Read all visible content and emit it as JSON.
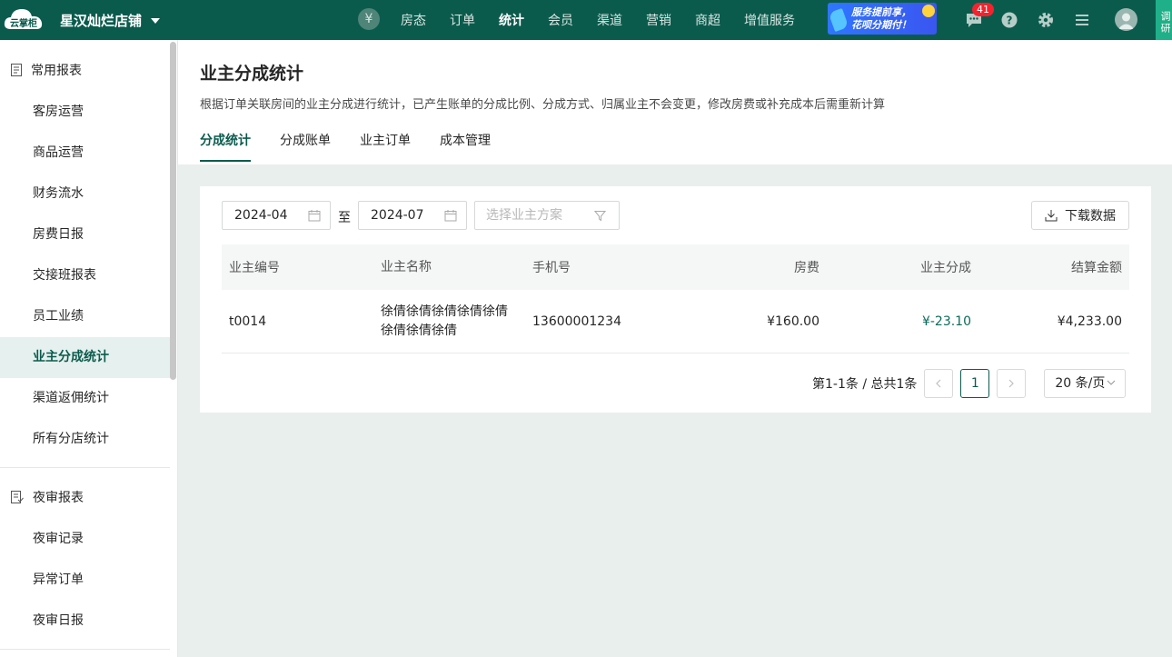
{
  "header": {
    "logo_text": "云掌柜",
    "store_name": "星汉灿烂店铺",
    "yen_symbol": "¥",
    "nav": [
      {
        "label": "房态"
      },
      {
        "label": "订单"
      },
      {
        "label": "统计",
        "active": true
      },
      {
        "label": "会员"
      },
      {
        "label": "渠道"
      },
      {
        "label": "营销"
      },
      {
        "label": "商超"
      },
      {
        "label": "增值服务"
      }
    ],
    "banner_line1": "服务提前享，",
    "banner_line2": "花呗分期付！",
    "message_count": "41",
    "survey_label": "调研",
    "accent_color": "#0b5b4d"
  },
  "sidebar": {
    "group1": {
      "label": "常用报表",
      "icon": "report-icon"
    },
    "items1": [
      {
        "label": "客房运营"
      },
      {
        "label": "商品运营"
      },
      {
        "label": "财务流水"
      },
      {
        "label": "房费日报"
      },
      {
        "label": "交接班报表"
      },
      {
        "label": "员工业绩"
      },
      {
        "label": "业主分成统计",
        "active": true
      },
      {
        "label": "渠道返佣统计"
      },
      {
        "label": "所有分店统计"
      }
    ],
    "group2": {
      "label": "夜审报表",
      "icon": "audit-report-icon"
    },
    "items2": [
      {
        "label": "夜审记录"
      },
      {
        "label": "异常订单"
      },
      {
        "label": "夜审日报"
      }
    ]
  },
  "page": {
    "title": "业主分成统计",
    "description": "根据订单关联房间的业主分成进行统计，已产生账单的分成比例、分成方式、归属业主不会变更，修改房费或补充成本后需重新计算",
    "tabs": [
      {
        "label": "分成统计",
        "active": true
      },
      {
        "label": "分成账单"
      },
      {
        "label": "业主订单"
      },
      {
        "label": "成本管理"
      }
    ]
  },
  "filters": {
    "start_date": "2024-04",
    "separator": "至",
    "end_date": "2024-07",
    "owner_plan_placeholder": "选择业主方案",
    "download_label": "下载数据"
  },
  "table": {
    "columns": [
      "业主编号",
      "业主名称",
      "手机号",
      "房费",
      "业主分成",
      "结算金额"
    ],
    "rows": [
      {
        "owner_id": "t0014",
        "owner_name_line1": "徐倩徐倩徐倩徐倩徐倩",
        "owner_name_line2": "徐倩徐倩徐倩",
        "phone": "13600001234",
        "room_fee": "¥160.00",
        "owner_share": "¥-23.10",
        "settlement": "¥4,233.00"
      }
    ]
  },
  "pagination": {
    "summary": "第1-1条 / 总共1条",
    "current_page": "1",
    "page_size": "20 条/页"
  }
}
